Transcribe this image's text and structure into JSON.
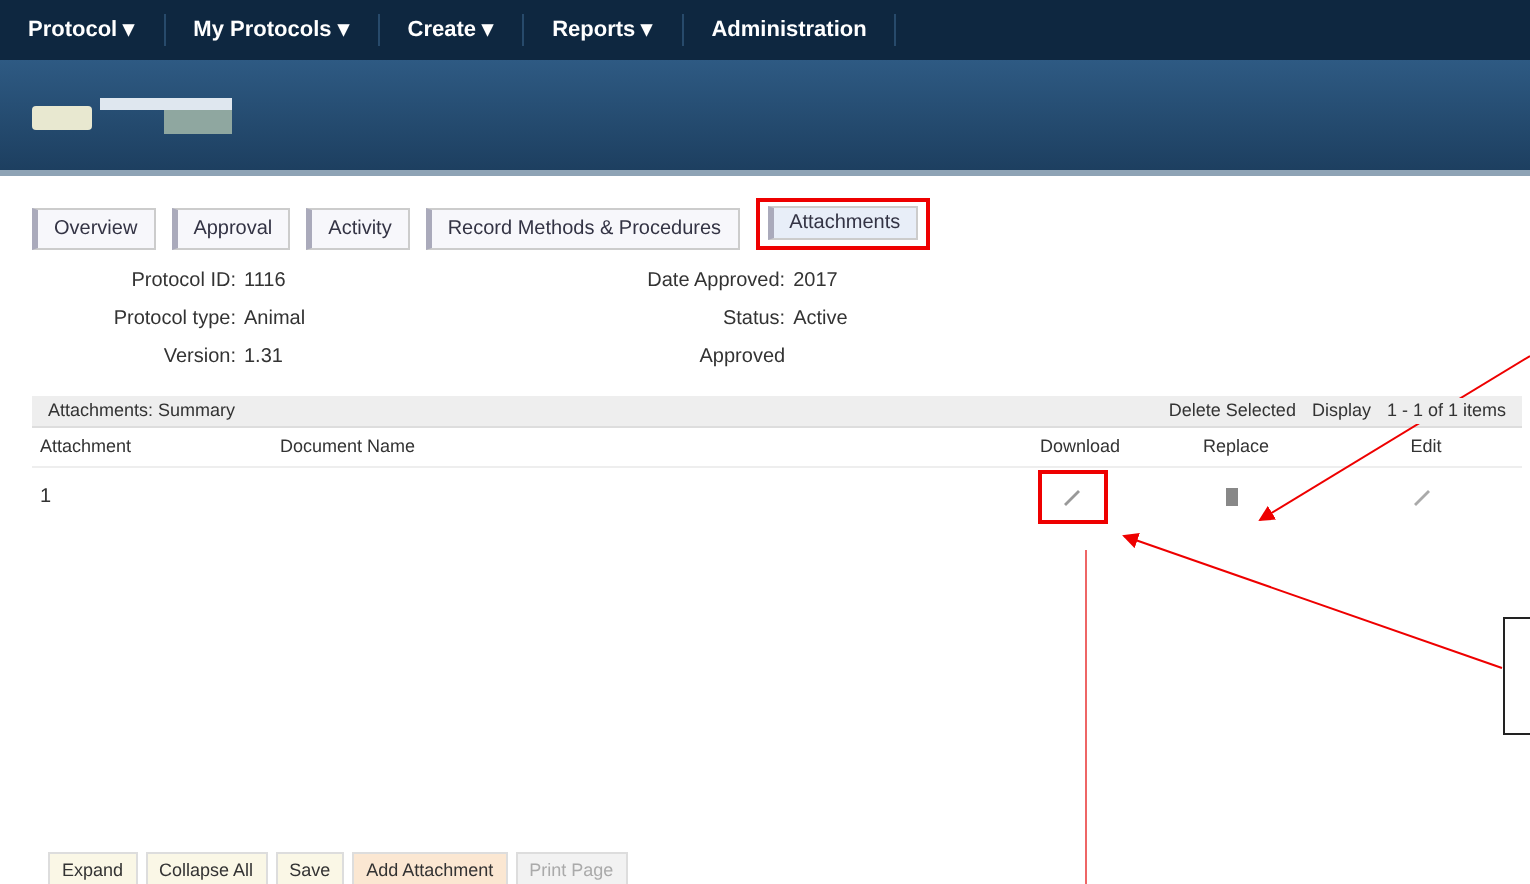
{
  "top_menu": [
    {
      "label": "Protocol ▾"
    },
    {
      "label": "My Protocols ▾"
    },
    {
      "label": "Create ▾"
    },
    {
      "label": "Reports ▾"
    },
    {
      "label": "Administration"
    }
  ],
  "tabs": [
    {
      "label": "Overview",
      "selected": false,
      "annotated": false
    },
    {
      "label": "Approval",
      "selected": false,
      "annotated": false
    },
    {
      "label": "Activity",
      "selected": false,
      "annotated": false
    },
    {
      "label": "Record Methods & Procedures",
      "selected": false,
      "annotated": false
    },
    {
      "label": "Attachments",
      "selected": true,
      "annotated": true
    }
  ],
  "details": {
    "left": [
      {
        "label": "Protocol ID:",
        "value": "1116"
      },
      {
        "label": "Protocol type:",
        "value": "Animal"
      },
      {
        "label": "Version:",
        "value": "1.31"
      }
    ],
    "right": [
      {
        "label": "Date Approved:",
        "value": "2017"
      },
      {
        "label": "Status:",
        "value": "Active"
      },
      {
        "label": "Approved"
      }
    ]
  },
  "grid": {
    "title": "Attachments: Summary",
    "toolbar": [
      "Delete Selected",
      "Display",
      "1 - 1 of 1 items"
    ],
    "columns": [
      "Attachment",
      "Document Name",
      "Download",
      "Replace",
      "Edit"
    ],
    "rows": [
      {
        "number": "1"
      }
    ]
  },
  "buttons": [
    {
      "label": "Expand",
      "disabled": false
    },
    {
      "label": "Collapse All",
      "disabled": false
    },
    {
      "label": "Save",
      "disabled": false
    },
    {
      "label": "Add Attachment",
      "disabled": false
    },
    {
      "label": "Print Page",
      "disabled": true
    }
  ]
}
